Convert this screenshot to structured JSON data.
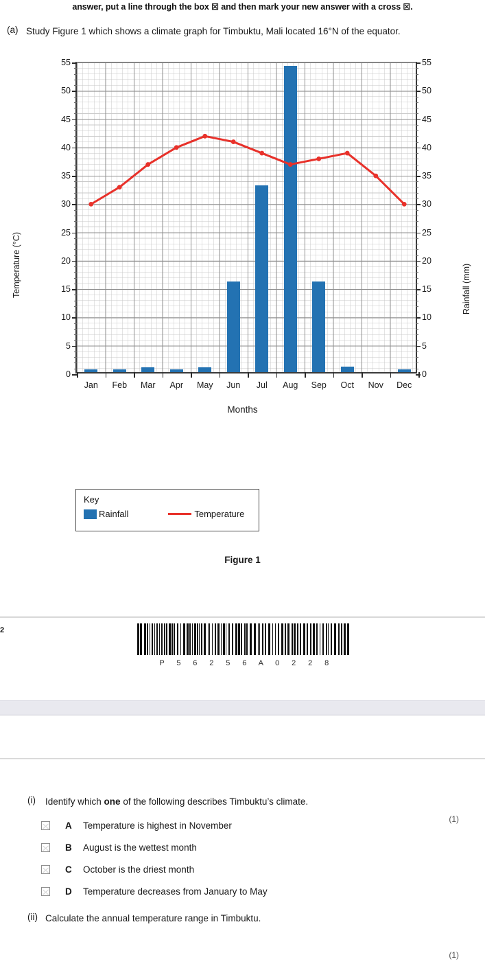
{
  "header": {
    "instruction_prefix": "answer, put a line through the box",
    "instruction_mid": "and then mark your new answer with a cross",
    "instruction_suffix": ".",
    "box_glyph": "☒",
    "cross_glyph": "☒"
  },
  "part_a": {
    "label": "(a)",
    "text": "Study Figure 1 which shows a climate graph for Timbuktu, Mali located 16°N of the equator."
  },
  "figure": {
    "caption": "Figure 1",
    "key_title": "Key",
    "key_rainfall": "Rainfall",
    "key_temperature": "Temperature"
  },
  "colors": {
    "rainfall_bar": "#2372b2",
    "temperature_line": "#e8312a",
    "grid_major": "#8d8d8d",
    "grid_minor": "#c9c9c9",
    "axis": "#3a3a3a"
  },
  "chart_data": {
    "type": "bar",
    "title": "Climate graph for Timbuktu, Mali",
    "xlabel": "Months",
    "ylabel": "Temperature (°C)",
    "y2label": "Rainfall (mm)",
    "categories": [
      "Jan",
      "Feb",
      "Mar",
      "Apr",
      "May",
      "Jun",
      "Jul",
      "Aug",
      "Sep",
      "Oct",
      "Nov",
      "Dec"
    ],
    "ylim": [
      0,
      55
    ],
    "y2lim": [
      0,
      55
    ],
    "yticks": [
      0,
      5,
      10,
      15,
      20,
      25,
      30,
      35,
      40,
      45,
      50,
      55
    ],
    "y2ticks": [
      0,
      5,
      10,
      15,
      20,
      25,
      30,
      35,
      40,
      45,
      50,
      55
    ],
    "grid": true,
    "minor_grid": true,
    "legend": "inside-box-below-axis",
    "series": [
      {
        "name": "Rainfall",
        "type": "bar",
        "axis": "right",
        "unit": "mm",
        "color": "#2372b2",
        "values": [
          0.5,
          0.5,
          0.8,
          0.5,
          0.8,
          16,
          33,
          54,
          16,
          1,
          0,
          0.5
        ]
      },
      {
        "name": "Temperature",
        "type": "line",
        "axis": "left",
        "unit": "°C",
        "color": "#e8312a",
        "values": [
          30,
          33,
          37,
          40,
          42,
          41,
          39,
          37,
          38,
          39,
          35,
          30
        ]
      }
    ]
  },
  "footer": {
    "page_number": "2",
    "barcode_text": "P 5 6 2 5 6 A 0 2 2 8"
  },
  "questions": [
    {
      "num": "(i)",
      "text_before_bold": "Identify which ",
      "bold": "one",
      "text_after_bold": " of the following describes Timbuktu’s climate.",
      "marks": "(1)",
      "options": [
        {
          "letter": "A",
          "text": "Temperature is highest in November"
        },
        {
          "letter": "B",
          "text": "August is the wettest month"
        },
        {
          "letter": "C",
          "text": "October is the driest month"
        },
        {
          "letter": "D",
          "text": "Temperature decreases from January to May"
        }
      ]
    },
    {
      "num": "(ii)",
      "text": "Calculate the annual temperature range in Timbuktu.",
      "marks": "(1)"
    }
  ]
}
